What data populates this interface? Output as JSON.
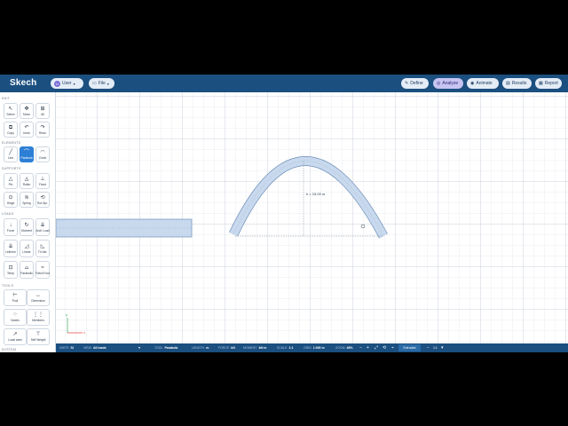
{
  "header": {
    "logo": "Skech",
    "user": {
      "avatar": "U",
      "label": "User"
    },
    "file_label": "File",
    "nav": [
      {
        "label": "Define",
        "icon": "define-icon",
        "active": false
      },
      {
        "label": "Analyze",
        "icon": "analyze-icon",
        "active": true
      },
      {
        "label": "Animate",
        "icon": "animate-icon",
        "active": false
      },
      {
        "label": "Results",
        "icon": "results-icon",
        "active": false
      },
      {
        "label": "Report",
        "icon": "report-icon",
        "active": false
      }
    ]
  },
  "sidebar": {
    "sections": {
      "edit": "EDIT",
      "elements": "ELEMENTS",
      "supports": "SUPPORTS",
      "loads": "LOADS",
      "tools": "TOOLS",
      "system": "SYSTEM"
    },
    "edit": [
      {
        "label": "Select",
        "glyph": "↖"
      },
      {
        "label": "Move",
        "glyph": "✥"
      },
      {
        "label": "All",
        "glyph": "⊞"
      },
      {
        "label": "Copy",
        "glyph": "⧉"
      },
      {
        "label": "Undo",
        "glyph": "↶"
      },
      {
        "label": "Redo",
        "glyph": "↷"
      }
    ],
    "elements": [
      {
        "label": "Line",
        "glyph": "╱"
      },
      {
        "label": "Parabola",
        "glyph": "⌒"
      },
      {
        "label": "Circle",
        "glyph": "◠"
      }
    ],
    "supports": [
      {
        "label": "Pin",
        "glyph": "△"
      },
      {
        "label": "Roller",
        "glyph": "◬"
      },
      {
        "label": "Fixed",
        "glyph": "⊥"
      },
      {
        "label": "Hinge",
        "glyph": "⊙"
      },
      {
        "label": "Spring",
        "glyph": "≋"
      },
      {
        "label": "Rot.Spr.",
        "glyph": "⟲"
      }
    ],
    "loads": [
      {
        "label": "Force",
        "glyph": "↓"
      },
      {
        "label": "Moment",
        "glyph": "↻"
      },
      {
        "label": "Arch Load",
        "glyph": "⇊"
      },
      {
        "label": "Uniform",
        "glyph": "⇊"
      },
      {
        "label": "Linear",
        "glyph": "◿"
      },
      {
        "label": "Tri.Var.",
        "glyph": "◺"
      },
      {
        "label": "Temp",
        "glyph": "⊡"
      },
      {
        "label": "Parabolic",
        "glyph": "⌓"
      },
      {
        "label": "Fabri.Error",
        "glyph": "≈"
      }
    ],
    "tools": [
      {
        "label": "Pool",
        "glyph": "⊢"
      },
      {
        "label": "Dimension",
        "glyph": "↔"
      },
      {
        "label": "Nodes",
        "glyph": "⁘"
      },
      {
        "label": "Members",
        "glyph": "⋮⋮"
      },
      {
        "label": "Local axes",
        "glyph": "↗"
      },
      {
        "label": "Self Weight",
        "glyph": "⊤"
      }
    ]
  },
  "canvas": {
    "dimension_label": "h = 15.00 m",
    "axis_x": "x",
    "axis_y": "y"
  },
  "status": {
    "units_key": "UNITS",
    "units_val": "SI",
    "view_key": "VIEW",
    "view_val": "All loads",
    "tool_key": "TOOL",
    "tool_val": "Parabola",
    "length_key": "LENGTH",
    "length_val": "m",
    "force_key": "FORCE",
    "force_val": "kN",
    "moment_key": "MOMENT",
    "moment_val": "kN·m",
    "scale_key": "SCALE",
    "scale_val": "1:1",
    "grid_key": "GRID",
    "grid_val": "1.000 m",
    "zoom_key": "ZOOM",
    "zoom_val": "46%",
    "mode": "Extruded"
  },
  "colors": {
    "header": "#1b4f80",
    "accent": "#2d7fd6",
    "member_fill": "#c8d9ee",
    "member_stroke": "#6e8fb8"
  }
}
